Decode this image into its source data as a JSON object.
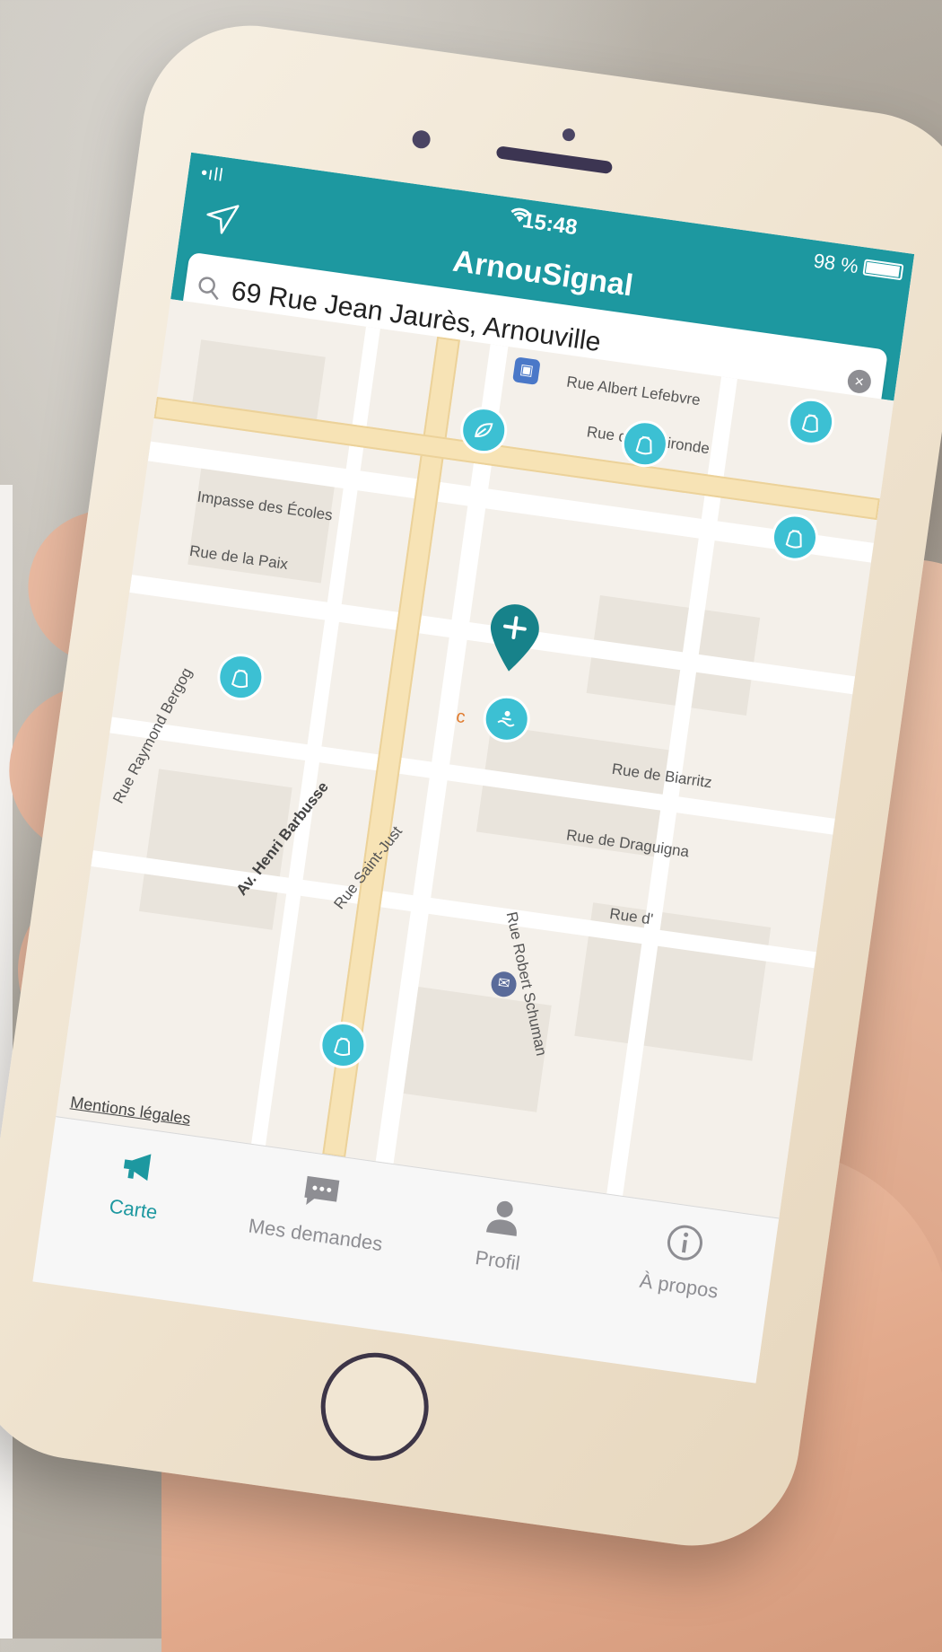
{
  "status_bar": {
    "signal": "•ıll",
    "time": "15:48",
    "battery": "98 %"
  },
  "app": {
    "title": "ArnouSignal"
  },
  "search": {
    "value": "69 Rue Jean Jaurès, Arnouville",
    "clear_icon": "clear-icon"
  },
  "map": {
    "street_labels": {
      "albert_lefebvre": "Rue Albert Lefebvre",
      "gironde": "Rue de la Gironde",
      "ecoles": "Impasse des Écoles",
      "paix": "Rue de la Paix",
      "biarritz": "Rue de Biarritz",
      "draguignan": "Rue de Draguigna",
      "rue_d": "Rue d'",
      "bergog": "Rue Raymond Bergog",
      "barbusse": "Av. Henri Barbusse",
      "saint_just": "Rue Saint-Just",
      "schuman": "Rue Robert Schuman"
    },
    "poi_text": "c",
    "legal_link": "Mentions légales"
  },
  "tabs": [
    {
      "label": "Carte",
      "icon": "megaphone-icon",
      "active": true
    },
    {
      "label": "Mes demandes",
      "icon": "chat-bubble-icon",
      "active": false
    },
    {
      "label": "Profil",
      "icon": "person-icon",
      "active": false
    },
    {
      "label": "À propos",
      "icon": "info-icon",
      "active": false
    }
  ],
  "colors": {
    "accent": "#1d98a0",
    "pin": "#3cc0d3"
  }
}
